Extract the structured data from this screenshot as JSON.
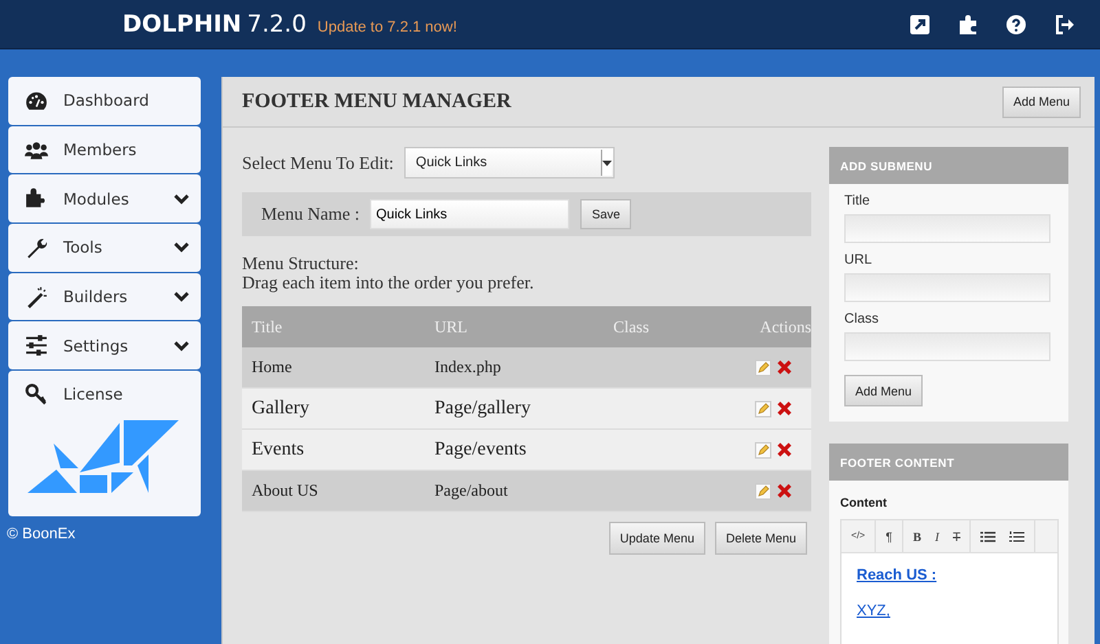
{
  "header": {
    "brand": "DOLPHIN",
    "version": "7.2.0",
    "update_notice": "Update to 7.2.1 now!"
  },
  "sidebar": {
    "items": [
      {
        "label": "Dashboard",
        "expandable": false
      },
      {
        "label": "Members",
        "expandable": false
      },
      {
        "label": "Modules",
        "expandable": true
      },
      {
        "label": "Tools",
        "expandable": true
      },
      {
        "label": "Builders",
        "expandable": true
      },
      {
        "label": "Settings",
        "expandable": true
      },
      {
        "label": "License",
        "expandable": false
      }
    ],
    "copyright": "© BoonEx"
  },
  "page": {
    "title": "FOOTER MENU MANAGER",
    "add_menu_button": "Add Menu"
  },
  "menu_select": {
    "label": "Select Menu To Edit:",
    "value": "Quick Links"
  },
  "menu_name": {
    "label": "Menu Name :",
    "value": "Quick Links",
    "save_button": "Save"
  },
  "structure": {
    "heading": "Menu Structure:",
    "hint": "Drag each item into the order you prefer."
  },
  "table": {
    "columns": [
      "Title",
      "URL",
      "Class",
      "Actions"
    ],
    "rows": [
      {
        "title": "Home",
        "url": "Index.php",
        "highlighted": true
      },
      {
        "title": "Gallery",
        "url": "Page/gallery",
        "highlighted": false
      },
      {
        "title": "Events",
        "url": "Page/events",
        "highlighted": false
      },
      {
        "title": "About US",
        "url": "Page/about",
        "highlighted": true
      }
    ]
  },
  "table_buttons": [
    "Update Menu",
    "Delete Menu"
  ],
  "add_submenu": {
    "heading": "ADD SUBMENU",
    "fields": [
      "Title",
      "URL",
      "Class"
    ],
    "button": "Add Menu"
  },
  "footer_content": {
    "heading": "FOOTER CONTENT",
    "label": "Content",
    "toolbar": [
      {
        "kind": "code",
        "label": "</>"
      },
      {
        "kind": "paragraph",
        "label": "¶"
      },
      {
        "kind": "bold",
        "label": "B"
      },
      {
        "kind": "italic",
        "label": "I"
      },
      {
        "kind": "strike",
        "label": "T"
      },
      {
        "kind": "bullet-list"
      },
      {
        "kind": "number-list"
      }
    ],
    "links": [
      "Reach US :",
      "XYZ,"
    ]
  }
}
